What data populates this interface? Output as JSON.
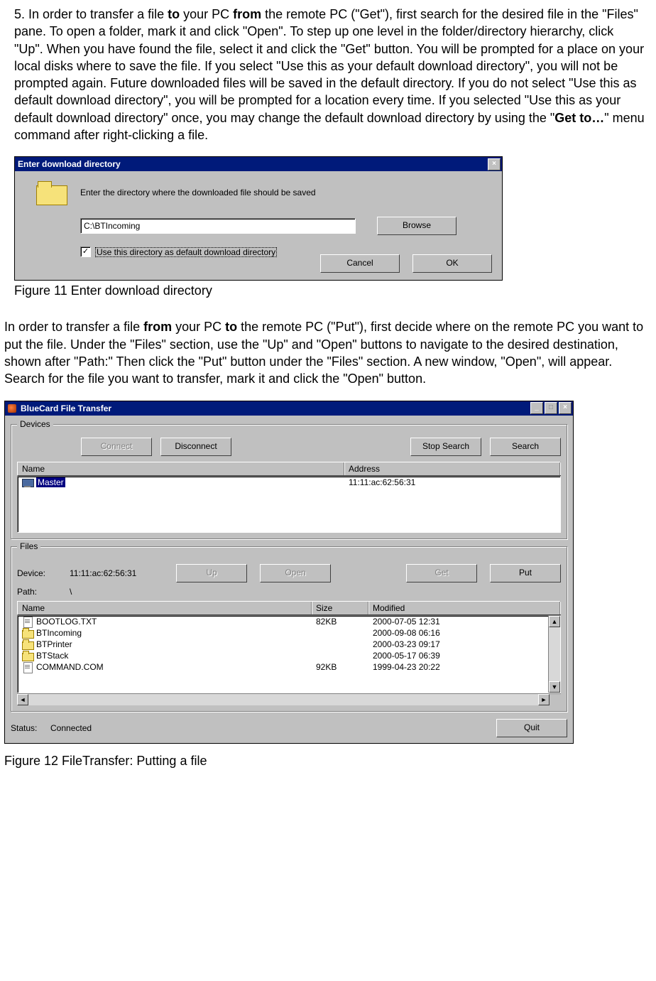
{
  "para1": {
    "p1a": "5. In order to transfer a file ",
    "p1b": "to",
    "p1c": " your PC ",
    "p1d": "from",
    "p1e": " the remote  PC (\"Get\"), first search for the desired file in the \"Files\" pane. To open a folder, mark it and click \"Open\". To step up  one level in the folder/directory hierarchy, click \"Up\". When you have found the file, select it and click the \"Get\" button. You will be prompted for a place on your local disks where to save the file. If you select \"Use this as your default download directory\", you will not be prompted again. Future downloaded files will be saved in the default directory. If you do not select \"Use this as default download directory\", you will be prompted for a location every time. If you selected \"Use this as your default download directory\" once, you may change the default download directory by using the \"",
    "p1f": "Get to…",
    "p1g": "\" menu command after right-clicking a file."
  },
  "dialog": {
    "title": "Enter download directory",
    "close": "×",
    "prompt": "Enter the directory where the downloaded file should be saved",
    "path": "C:\\BTIncoming",
    "browse": "Browse",
    "checkbox_checked": "✓",
    "checkbox_label": "Use this directory as default download directory",
    "cancel": "Cancel",
    "ok": "OK"
  },
  "caption1": "Figure 11 Enter download directory",
  "para2": {
    "a": "In order to transfer a file ",
    "b": "from",
    "c": " your PC ",
    "d": "to",
    "e": " the remote PC (\"Put\"), first decide where on the remote PC you want to put the file. Under the \"Files\" section, use the \"Up\" and \"Open\" buttons to navigate to the desired destination, shown after \"Path:\" Then click the \"Put\" button under the \"Files\" section. A new window, \"Open\", will appear. Search for the file you want to transfer, mark it and click the \"Open\" button."
  },
  "win": {
    "title": "BlueCard File Transfer",
    "min": "_",
    "max": "□",
    "close": "×",
    "devices": {
      "legend": "Devices",
      "connect": "Connect",
      "disconnect": "Disconnect",
      "stop": "Stop Search",
      "search": "Search",
      "col_name": "Name",
      "col_addr": "Address",
      "row_name": "Master",
      "row_addr": "11:11:ac:62:56:31"
    },
    "files": {
      "legend": "Files",
      "device_label": "Device:",
      "device_value": "11:11:ac:62:56:31",
      "up": "Up",
      "open": "Open",
      "get": "Get",
      "put": "Put",
      "path_label": "Path:",
      "path_value": "\\",
      "col_name": "Name",
      "col_size": "Size",
      "col_mod": "Modified",
      "rows": [
        {
          "name": "BOOTLOG.TXT",
          "size": "82KB",
          "mod": "2000-07-05 12:31",
          "type": "file"
        },
        {
          "name": "BTIncoming",
          "size": "",
          "mod": "2000-09-08 06:16",
          "type": "dir"
        },
        {
          "name": "BTPrinter",
          "size": "",
          "mod": "2000-03-23 09:17",
          "type": "dir"
        },
        {
          "name": "BTStack",
          "size": "",
          "mod": "2000-05-17 06:39",
          "type": "dir"
        },
        {
          "name": "COMMAND.COM",
          "size": "92KB",
          "mod": "1999-04-23 20:22",
          "type": "file"
        }
      ]
    },
    "status_label": "Status:",
    "status_value": "Connected",
    "quit": "Quit",
    "arrows": {
      "up": "▲",
      "down": "▼",
      "left": "◄",
      "right": "►"
    }
  },
  "caption2": "Figure 12 FileTransfer: Putting a file"
}
